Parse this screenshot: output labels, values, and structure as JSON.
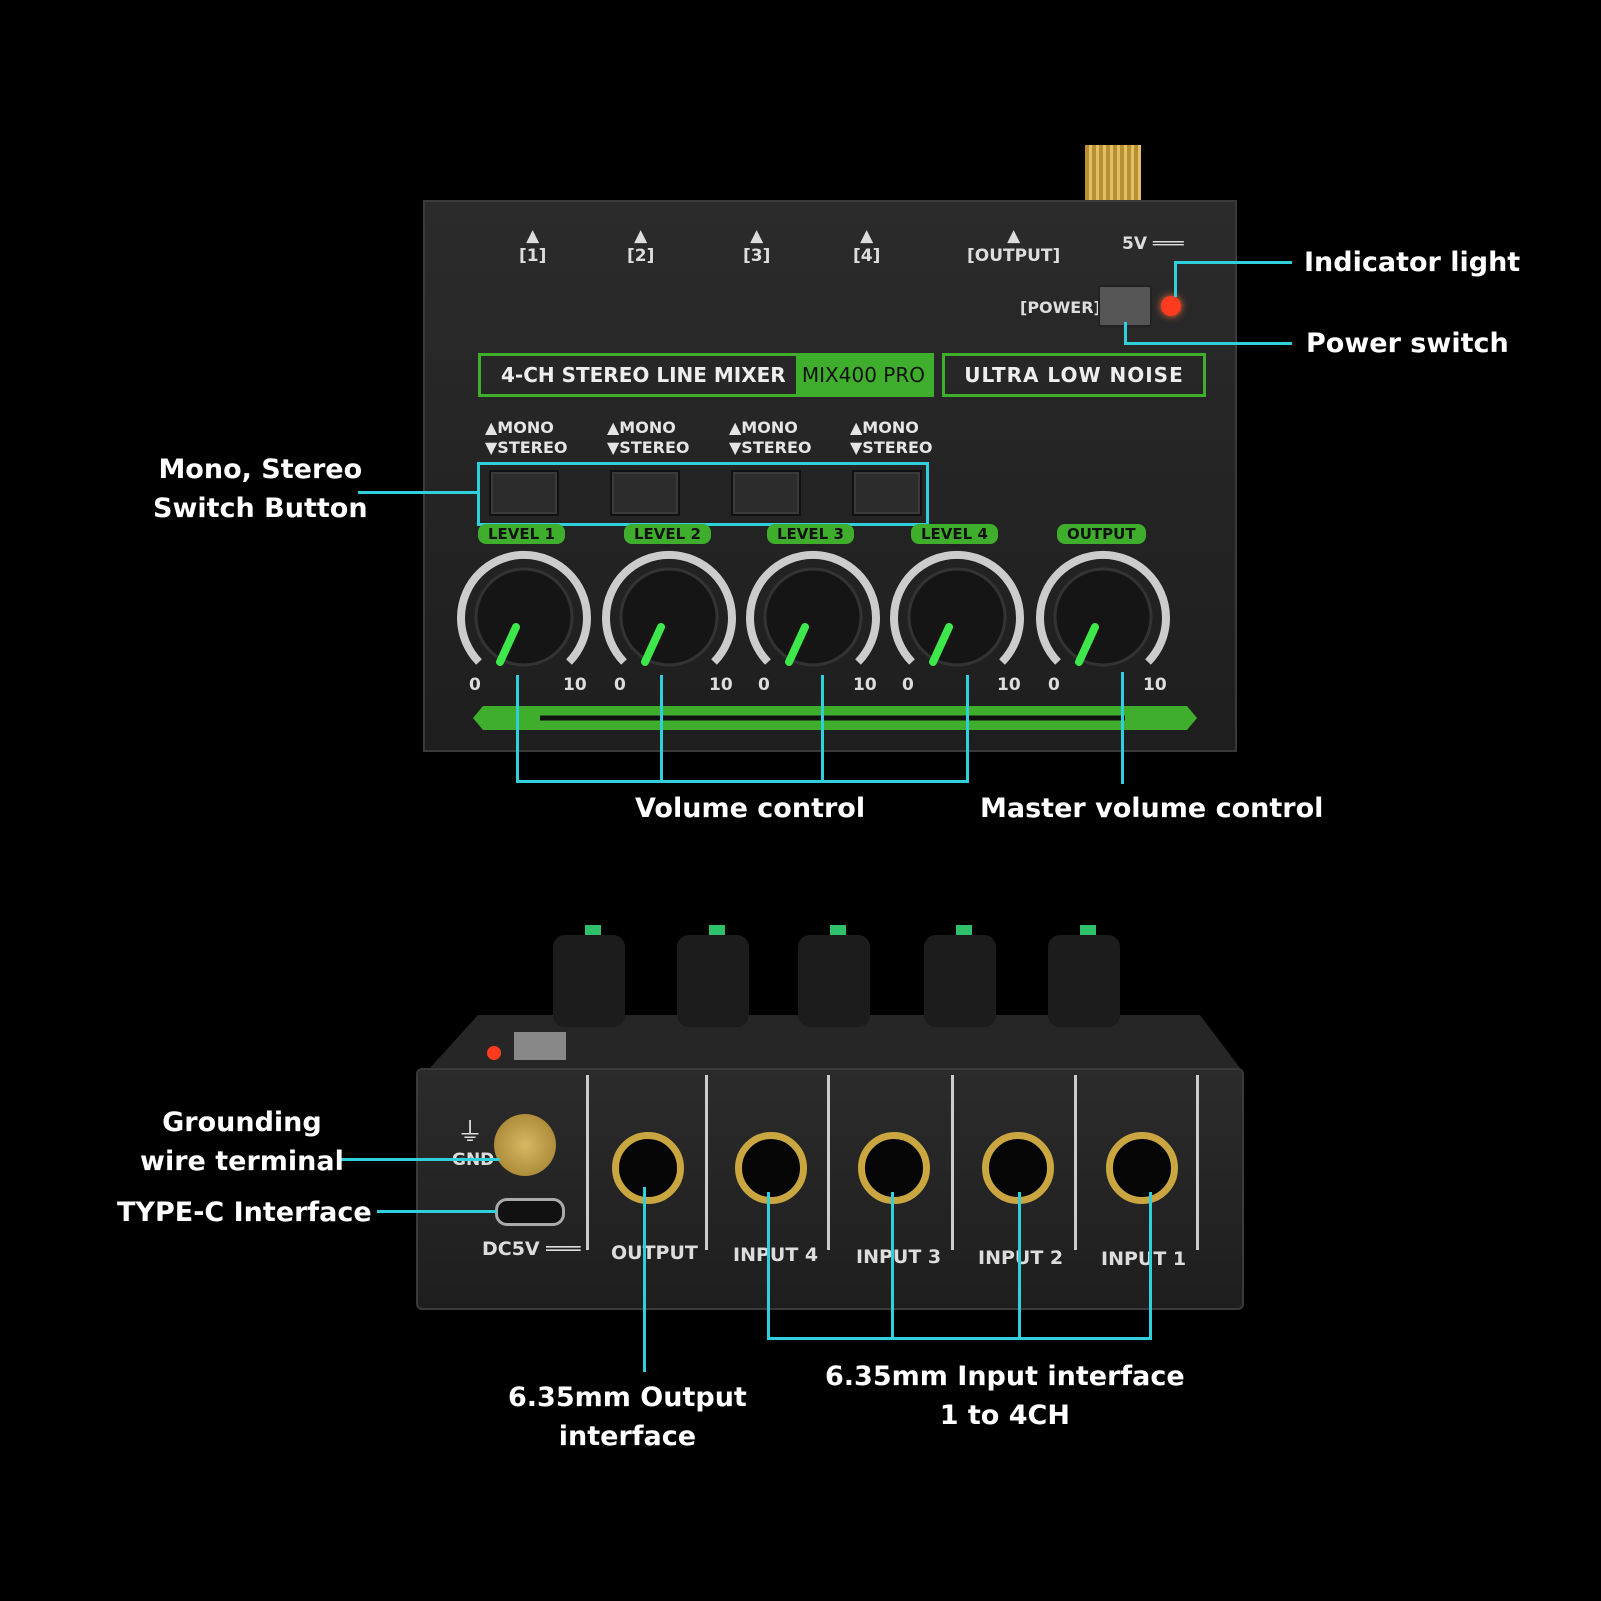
{
  "top_panel": {
    "channel_marks": [
      "[1]",
      "[2]",
      "[3]",
      "[4]",
      "[OUTPUT]"
    ],
    "voltage": "5V ═══",
    "power_label": "[POWER]",
    "title": "4-CH STEREO LINE MIXER",
    "model": "MIX400 PRO",
    "tagline": "ULTRA LOW NOISE",
    "mono_label": "▲MONO",
    "stereo_label": "▼STEREO",
    "knob_labels": [
      "LEVEL 1",
      "LEVEL 2",
      "LEVEL 3",
      "LEVEL 4",
      "OUTPUT"
    ],
    "scale_min": "0",
    "scale_max": "10"
  },
  "bottom_panel": {
    "gnd_label": "GND",
    "dc_label": "DC5V ═══",
    "jack_labels": [
      "OUTPUT",
      "INPUT 4",
      "INPUT 3",
      "INPUT 2",
      "INPUT 1"
    ]
  },
  "callouts": {
    "indicator_light": "Indicator light",
    "power_switch": "Power switch",
    "mono_stereo_1": "Mono, Stereo",
    "mono_stereo_2": "Switch Button",
    "volume_control": "Volume control",
    "master_volume": "Master volume control",
    "grounding_1": "Grounding",
    "grounding_2": "wire terminal",
    "type_c": "TYPE-C Interface",
    "output_if_1": "6.35mm Output",
    "output_if_2": "interface",
    "input_if_1": "6.35mm Input interface",
    "input_if_2": "1 to 4CH"
  },
  "colors": {
    "accent_line": "#2fd0dc",
    "panel_green": "#3fae2c",
    "led": "#ff3b1f",
    "gold": "#c9a640"
  }
}
